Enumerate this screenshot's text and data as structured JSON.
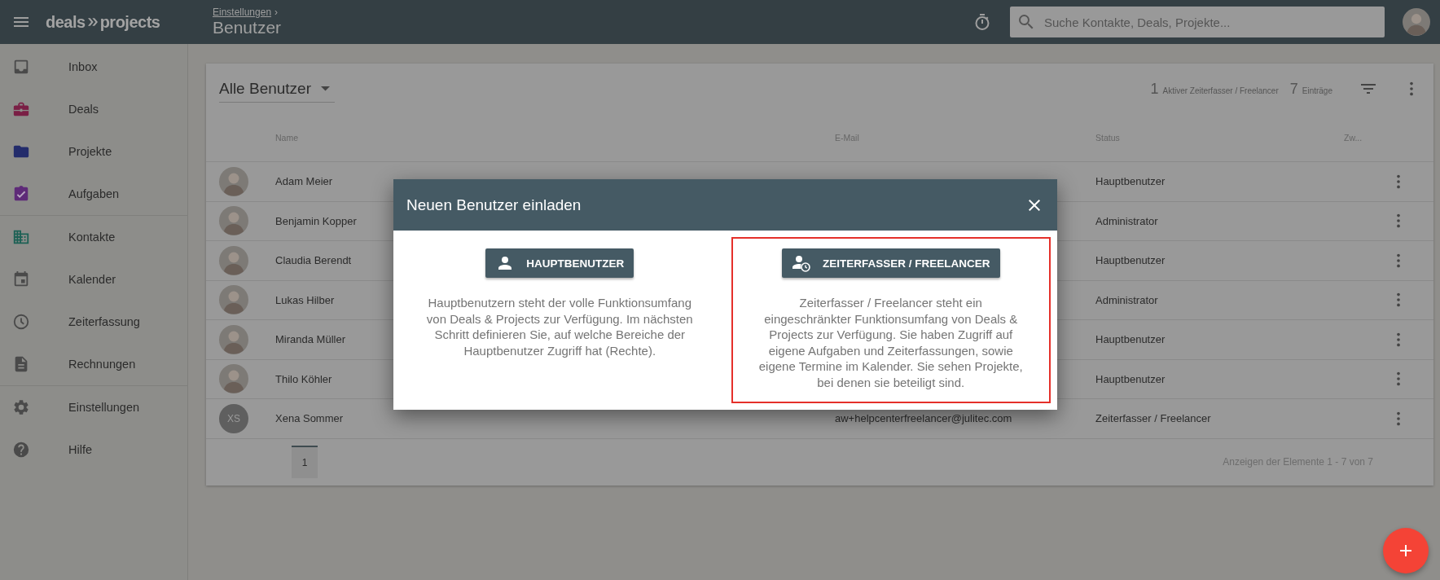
{
  "topbar": {
    "brand_left": "deals",
    "brand_right": "projects",
    "breadcrumb": "Einstellungen",
    "breadcrumb_sep": "›",
    "page_title": "Benutzer",
    "search": {
      "placeholder": "Suche Kontakte, Deals, Projekte..."
    }
  },
  "sidebar": {
    "sections": [
      {
        "items": [
          {
            "label": "Inbox",
            "color": "#4a4a4a"
          },
          {
            "label": "Deals",
            "color": "#7a1f45"
          },
          {
            "label": "Projekte",
            "color": "#232c6b"
          },
          {
            "label": "Aufgaben",
            "color": "#5e2a78"
          }
        ]
      },
      {
        "items": [
          {
            "label": "Kontakte",
            "color": "#1d6155"
          },
          {
            "label": "Kalender",
            "color": "#4a4a4a"
          },
          {
            "label": "Zeiterfassung",
            "color": "#4a4a4a"
          },
          {
            "label": "Rechnungen",
            "color": "#4a4a4a"
          }
        ]
      },
      {
        "items": [
          {
            "label": "Einstellungen",
            "color": "#4a4a4a"
          },
          {
            "label": "Hilfe",
            "color": "#4a4a4a"
          }
        ]
      }
    ]
  },
  "card": {
    "filter": "Alle Benutzer",
    "stats": [
      {
        "count": "1",
        "label": "Aktiver Zeiterfasser / Freelancer"
      },
      {
        "count": "7",
        "label": "Einträge"
      }
    ],
    "columns": [
      "Name",
      "E-Mail",
      "Status",
      "Zw..."
    ],
    "rows": [
      {
        "avatar": {
          "kind": "photo"
        },
        "name": "Adam Meier",
        "status": "Hauptbenutzer"
      },
      {
        "avatar": {
          "kind": "photo"
        },
        "name": "Benjamin Kopper",
        "status": "Administrator"
      },
      {
        "avatar": {
          "kind": "photo"
        },
        "name": "Claudia Berendt",
        "status": "Hauptbenutzer"
      },
      {
        "avatar": {
          "kind": "photo"
        },
        "name": "Lukas Hilber",
        "status": "Administrator"
      },
      {
        "avatar": {
          "kind": "photo"
        },
        "name": "Miranda Müller",
        "status": "Hauptbenutzer"
      },
      {
        "avatar": {
          "kind": "photo"
        },
        "name": "Thilo Köhler",
        "status": "Hauptbenutzer"
      },
      {
        "avatar": {
          "kind": "initials",
          "initials": "XS"
        },
        "name": "Xena Sommer",
        "email": "aw+helpcenterfreelancer@julitec.com",
        "status": "Zeiterfasser / Freelancer"
      }
    ],
    "pagination": {
      "pages": [
        {
          "label": "1",
          "selected": true
        }
      ],
      "summary": "Anzeigen der Elemente 1 - 7 von 7"
    }
  },
  "dialog": {
    "title": "Neuen Benutzer einladen",
    "options": [
      {
        "button": "HAUPTBENUTZER",
        "description": "Hauptbenutzern steht der volle Funktionsumfang von Deals & Projects zur Verfügung. Im nächsten Schritt definieren Sie, auf welche Bereiche der Hauptbenutzer Zugriff hat (Rechte).",
        "selected": false
      },
      {
        "button": "ZEITERFASSER / FREELANCER",
        "description": "Zeiterfasser / Freelancer steht ein eingeschränkter Funktionsumfang von Deals & Projects zur Verfügung. Sie haben Zugriff auf eigene Aufgaben und Zeiterfassungen, sowie eigene Termine im Kalender. Sie sehen Projekte, bei denen sie beteiligt sind.",
        "selected": true
      }
    ]
  }
}
